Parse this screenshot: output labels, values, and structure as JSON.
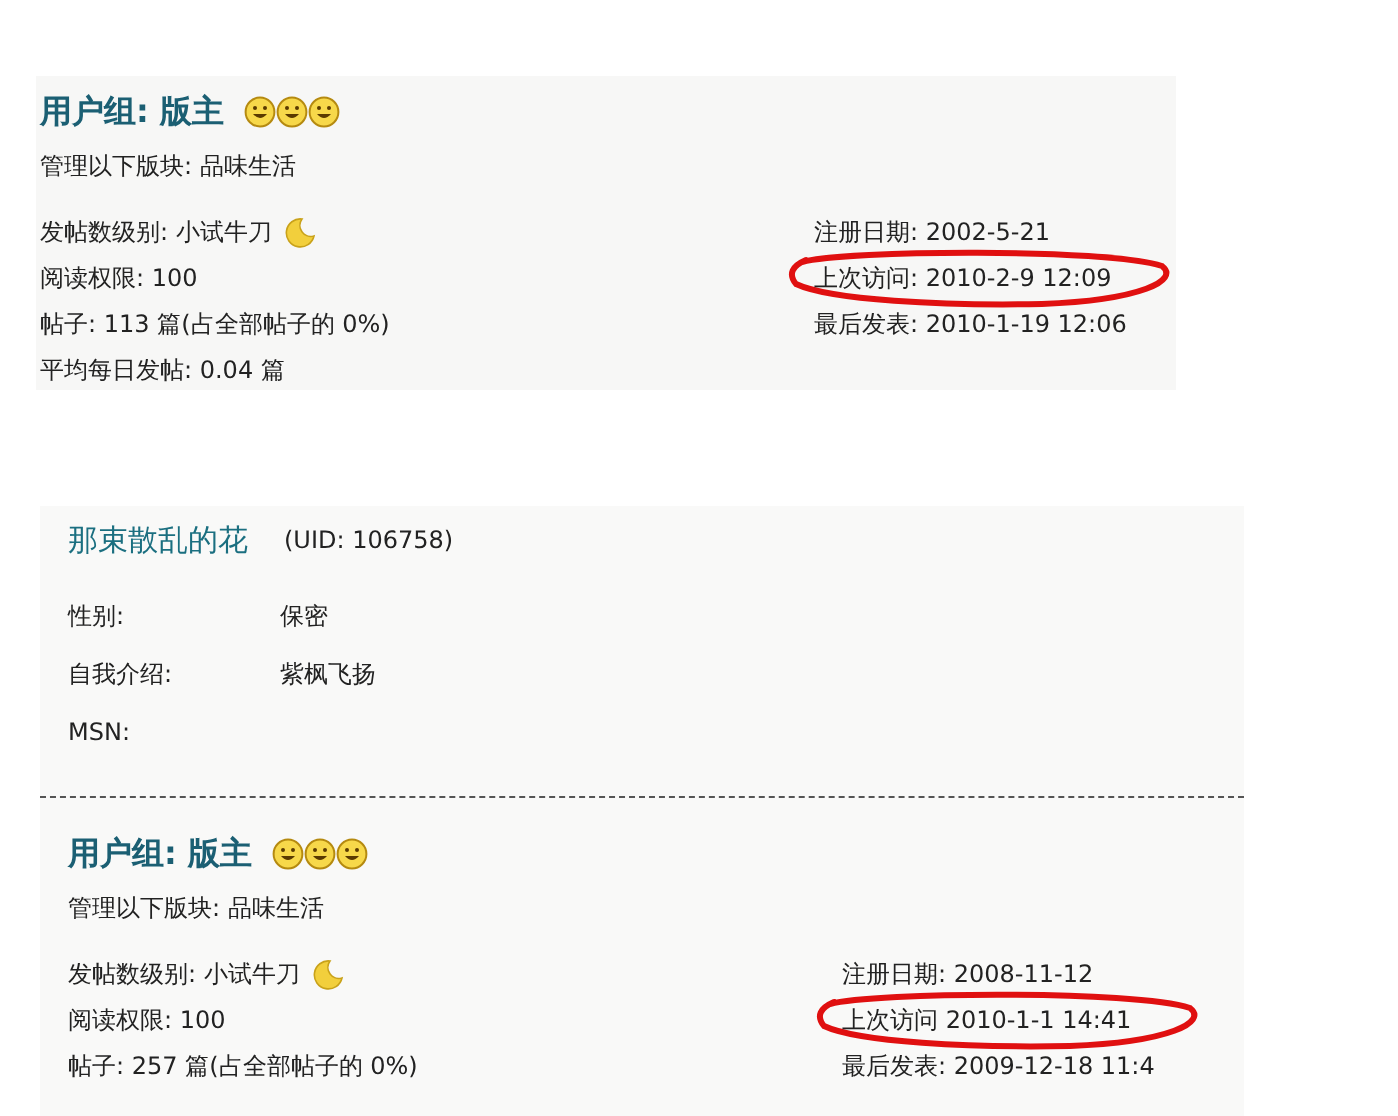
{
  "top_card": {
    "group": {
      "title": "用户组: 版主",
      "moderates": "管理以下版块: 品味生活",
      "left": [
        {
          "text": "发帖数级别: 小试牛刀",
          "kind": "rank"
        },
        {
          "text": "阅读权限: 100"
        },
        {
          "text": "帖子: 113 篇(占全部帖子的  0%)"
        },
        {
          "text": "平均每日发帖: 0.04 篇"
        }
      ],
      "right": [
        {
          "text": "注册日期: 2002-5-21",
          "circled": false
        },
        {
          "text": "上次访问: 2010-2-9 12:09",
          "circled": true
        },
        {
          "text": "最后发表: 2010-1-19 12:06",
          "circled": false
        }
      ]
    }
  },
  "profile_card": {
    "name": "那束散乱的花",
    "uid": "(UID: 106758)",
    "fields": [
      {
        "label": "性别:",
        "value": "保密"
      },
      {
        "label": "自我介绍:",
        "value": "紫枫飞扬"
      },
      {
        "label": "MSN:"
      }
    ],
    "group": {
      "title": "用户组: 版主",
      "moderates": "管理以下版块: 品味生活",
      "left": [
        {
          "text": "发帖数级别: 小试牛刀",
          "kind": "rank"
        },
        {
          "text": "阅读权限: 100"
        },
        {
          "text": "帖子: 257 篇(占全部帖子的  0%)"
        }
      ],
      "right": [
        {
          "text": "注册日期: 2008-11-12",
          "circled": false
        },
        {
          "text": "上次访问 2010-1-1 14:41",
          "circled": true
        },
        {
          "text": "最后发表: 2009-12-18 11:4",
          "circled": false
        }
      ]
    }
  }
}
